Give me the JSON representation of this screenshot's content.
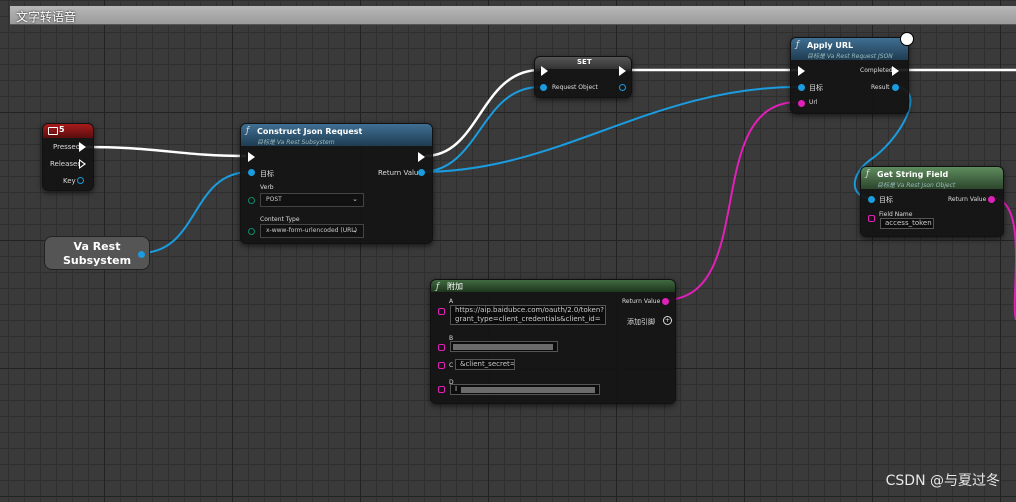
{
  "window": {
    "title": "文字转语音"
  },
  "key_event": {
    "title": "5",
    "pins": [
      "Pressed",
      "Released",
      "Key"
    ]
  },
  "var_node": {
    "label_line1": "Va Rest",
    "label_line2": "Subsystem"
  },
  "construct_json": {
    "title": "Construct Json Request",
    "subtitle": "目标是 Va Rest Subsystem",
    "target_label": "目标",
    "verb_label": "Verb",
    "verb_value": "POST",
    "content_type_label": "Content Type",
    "content_type_value": "x-www-form-urlencoded (URL)",
    "return_label": "Return Value"
  },
  "set_node": {
    "title": "SET",
    "request_object_label": "Request Object"
  },
  "apply_url": {
    "title": "Apply URL",
    "subtitle": "目标是 Va Rest Request JSON",
    "completed_label": "Completed",
    "target_label": "目标",
    "result_label": "Result",
    "url_label": "Url"
  },
  "get_string_field": {
    "title": "Get String Field",
    "subtitle": "目标是 Va Rest Json Object",
    "target_label": "目标",
    "return_label": "Return Value",
    "field_name_label": "Field Name",
    "field_name_value": "access_token"
  },
  "append_node": {
    "title": "附加",
    "return_label": "Return Value",
    "add_pin_label": "添加引脚",
    "a_label": "A",
    "a_value_line1": "https://aip.baidubce.com/oauth/2.0/token?",
    "a_value_line2": "grant_type=client_credentials&client_id=",
    "b_label": "B",
    "c_label": "C",
    "c_value": "&client_secret=",
    "d_label": "D",
    "d_value": "I"
  },
  "watermark": "CSDN @与夏过冬",
  "colors": {
    "exec_wire": "#ffffff",
    "object_wire": "#1a9cdf",
    "string_wire": "#e21fb8"
  }
}
